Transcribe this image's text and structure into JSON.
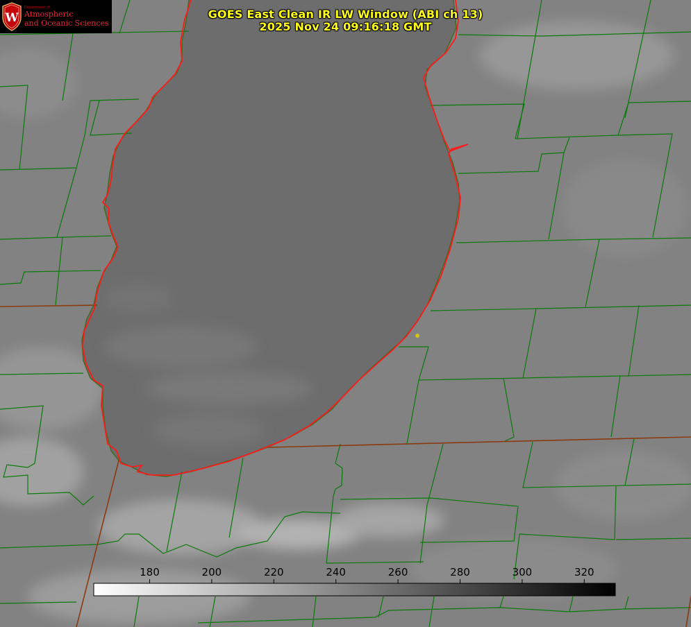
{
  "title": {
    "line1": "GOES East Clean IR LW Window (ABI ch 13)",
    "line2": "2025 Nov 24 09:16:18 GMT"
  },
  "logo": {
    "dept": "Department of",
    "name_line1": "Atmospheric",
    "name_line2": "and Oceanic Sciences",
    "seal_letter": "W"
  },
  "colorbar": {
    "min": 162,
    "max": 330,
    "ticks": [
      "180",
      "200",
      "220",
      "240",
      "260",
      "280",
      "300",
      "320"
    ],
    "colormap": "white-to-black"
  },
  "map": {
    "lake_boundary_color": "#ff1a1a",
    "county_line_color": "#0a7a0a",
    "state_line_color": "#8a3a10",
    "marker_color": "#d4c417",
    "lake_tone": "#6f6f6f",
    "land_tone": "#888888"
  }
}
